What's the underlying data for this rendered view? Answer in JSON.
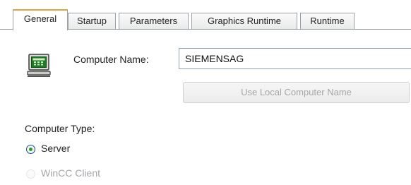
{
  "tabs": [
    {
      "label": "General",
      "active": true
    },
    {
      "label": "Startup",
      "active": false
    },
    {
      "label": "Parameters",
      "active": false
    },
    {
      "label": "Graphics Runtime",
      "active": false
    },
    {
      "label": "Runtime",
      "active": false
    }
  ],
  "form": {
    "computer_name_label": "Computer Name:",
    "computer_name_value": "SIEMENSAG",
    "use_local_button": "Use Local Computer Name",
    "computer_type_label": "Computer Type:",
    "type_options": [
      {
        "label": "Server",
        "selected": true,
        "enabled": true
      },
      {
        "label": "WinCC Client",
        "selected": false,
        "enabled": false
      }
    ]
  },
  "icons": {
    "computer": "computer-icon"
  },
  "colors": {
    "active_tab_accent": "#e6a23c",
    "radio_dot": "#2b9a2b",
    "disabled_text": "#a3a6a9"
  }
}
